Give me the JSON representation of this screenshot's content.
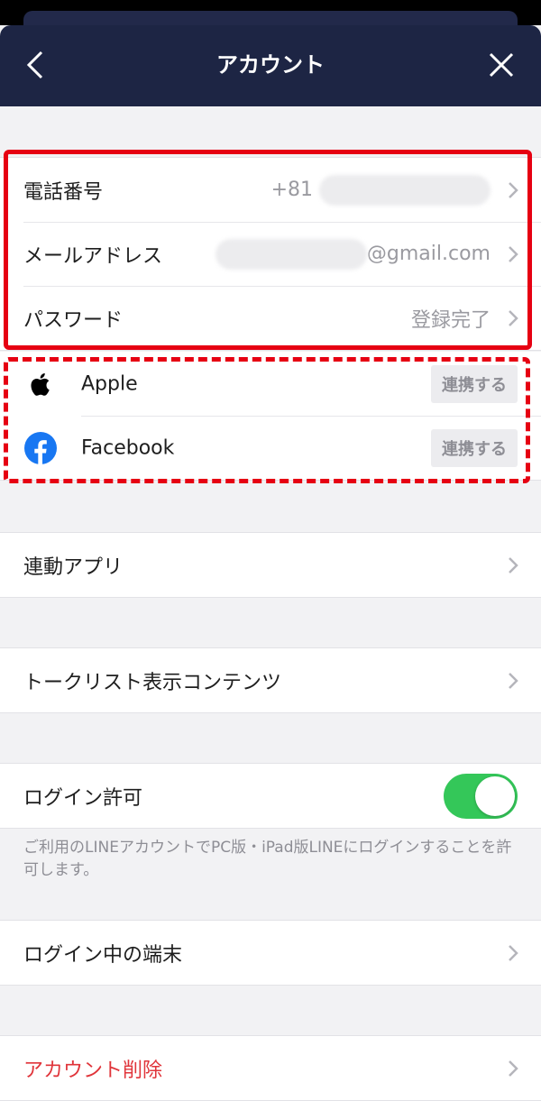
{
  "header": {
    "title": "アカウント"
  },
  "account": {
    "phone": {
      "label": "電話番号",
      "value": "+81"
    },
    "email": {
      "label": "メールアドレス",
      "value": "@gmail.com"
    },
    "password": {
      "label": "パスワード",
      "value": "登録完了"
    }
  },
  "services": [
    {
      "name": "Apple",
      "icon": "apple-icon",
      "button": "連携する"
    },
    {
      "name": "Facebook",
      "icon": "facebook-icon",
      "button": "連携する"
    }
  ],
  "menu": {
    "linked_apps": "連動アプリ",
    "talk_list": "トークリスト表示コンテンツ",
    "login_permission": "ログイン許可",
    "login_permission_enabled": true,
    "login_note": "ご利用のLINEアカウントでPC版・iPad版LINEにログインすることを許可します。",
    "logged_in_devices": "ログイン中の端末",
    "delete_account": "アカウント削除"
  },
  "colors": {
    "header_bg": "#1d2544",
    "annotation_red": "#e60012",
    "toggle_on": "#34c759",
    "danger_text": "#e0343a",
    "facebook_blue": "#1877f2"
  }
}
